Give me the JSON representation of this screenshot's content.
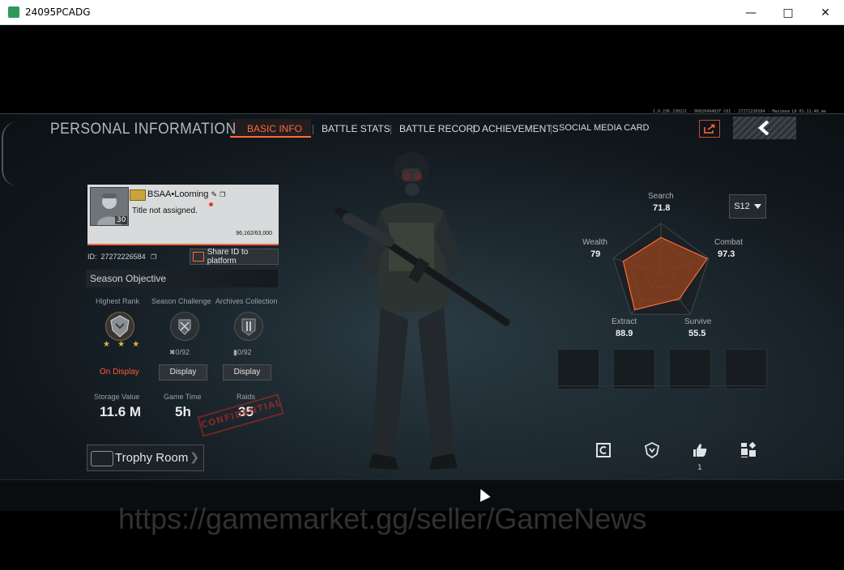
{
  "window": {
    "title": "24095PCADG"
  },
  "header": {
    "title": "PERSONAL INFORMATION",
    "version": "1.0.236.238221 · 0002049481F C6I · 27272226584 · Maximum L6 01.11.40,me",
    "tabs": [
      "BASIC INFO",
      "BATTLE STATS",
      "BATTLE RECORD",
      "ACHIEVEMENTS",
      "SOCIAL MEDIA CARD"
    ],
    "active_tab": 0
  },
  "profile": {
    "name": "BSAA•Looming",
    "title_text": "Title not assigned.",
    "level": "30",
    "xp": "96,162/63,000",
    "id_label": "ID:",
    "id_value": "27272226584",
    "share_label": "Share ID to platform"
  },
  "season_objective": {
    "header": "Season Objective",
    "col1_label": "Highest Rank",
    "col2_label": "Season Challenge",
    "col3_label": "Archives Collection",
    "stars": "★ ★ ★",
    "challenge_count": "0/92",
    "archive_count": "0/92",
    "on_display": "On Display",
    "display_btn_1": "Display",
    "display_btn_2": "Display"
  },
  "stats": {
    "storage_label": "Storage Value",
    "storage_value": "11.6 M",
    "time_label": "Game Time",
    "time_value": "5h",
    "raids_label": "Raids",
    "raids_value": "35",
    "stamp": "CONFIDENTIAL"
  },
  "trophy": {
    "label": "Trophy Room"
  },
  "radar": {
    "season": "S12",
    "axes": [
      {
        "label": "Search",
        "value": "71.8",
        "norm": 0.72
      },
      {
        "label": "Combat",
        "value": "97.3",
        "norm": 0.97
      },
      {
        "label": "Survive",
        "value": "55.5",
        "norm": 0.62
      },
      {
        "label": "Extract",
        "value": "88.9",
        "norm": 0.89
      },
      {
        "label": "Wealth",
        "value": "79",
        "norm": 0.79
      }
    ],
    "fill_color": "#8a3f1f",
    "stroke_color": "#ff6a3d"
  },
  "actions": {
    "like_count": "1"
  },
  "watermark": "https://gamemarket.gg/seller/GameNews"
}
